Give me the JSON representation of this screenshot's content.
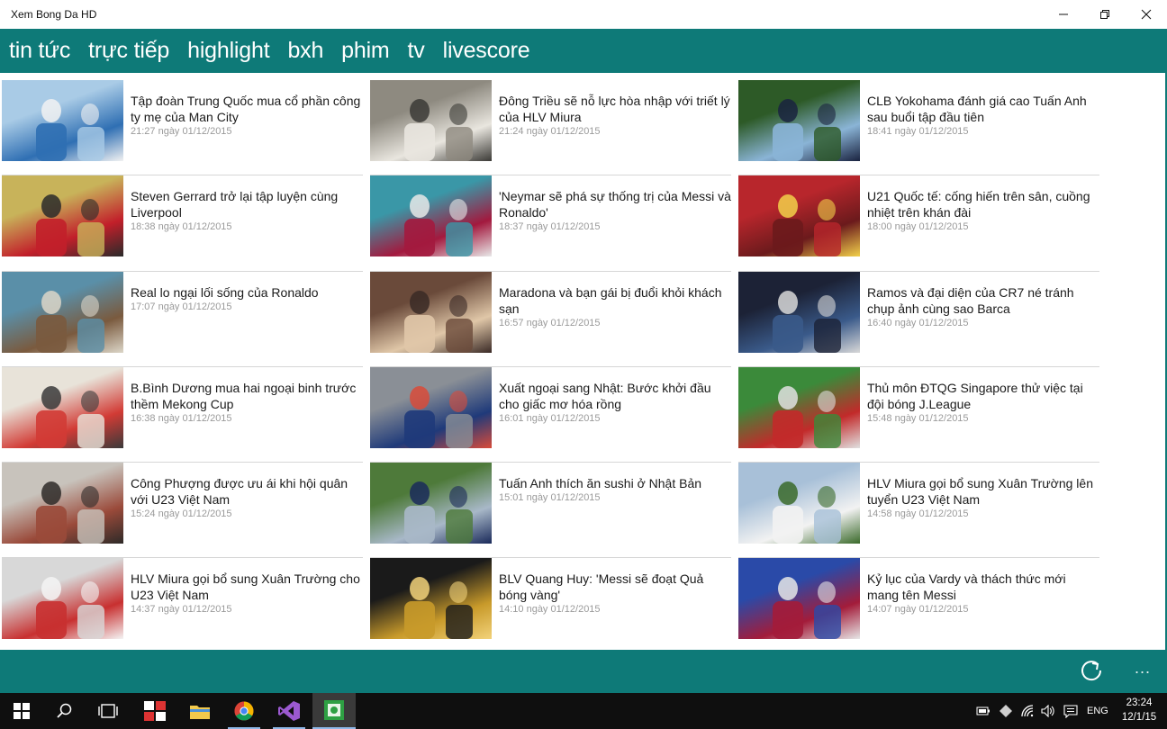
{
  "window": {
    "title": "Xem Bong Da HD",
    "controls": [
      "minimize",
      "restore",
      "close"
    ]
  },
  "nav": {
    "tabs": [
      "tin tức",
      "trực tiếp",
      "highlight",
      "bxh",
      "phim",
      "tv",
      "livescore"
    ]
  },
  "articles": [
    {
      "title": "Tập đoàn Trung Quốc mua cổ phần công ty mẹ của Man City",
      "time": "21:27 ngày 01/12/2015",
      "thumb": "photo-man-city-players"
    },
    {
      "title": "Đông Triều sẽ nỗ lực hòa nhập với triết lý của HLV Miura",
      "time": "21:24 ngày 01/12/2015",
      "thumb": "photo-player-portrait"
    },
    {
      "title": "CLB Yokohama đánh giá cao Tuấn Anh sau buổi tập đầu tiên",
      "time": "18:41 ngày 01/12/2015",
      "thumb": "photo-training-field"
    },
    {
      "title": "Steven Gerrard trở lại tập luyện cùng Liverpool",
      "time": "18:38 ngày 01/12/2015",
      "thumb": "photo-liverpool-training"
    },
    {
      "title": "'Neymar sẽ phá sự thống trị của Messi và Ronaldo'",
      "time": "18:37 ngày 01/12/2015",
      "thumb": "photo-three-stars"
    },
    {
      "title": "U21 Quốc tế: cống hiến trên sân, cuồng nhiệt trên khán đài",
      "time": "18:00 ngày 01/12/2015",
      "thumb": "photo-stadium-crowd"
    },
    {
      "title": "Real lo ngại lối sống của Ronaldo",
      "time": "17:07 ngày 01/12/2015",
      "thumb": "photo-pool-party"
    },
    {
      "title": "Maradona và bạn gái bị đuổi khỏi khách sạn",
      "time": "16:57 ngày 01/12/2015",
      "thumb": "photo-couple"
    },
    {
      "title": "Ramos và đại diện của CR7 né tránh chụp ảnh cùng sao Barca",
      "time": "16:40 ngày 01/12/2015",
      "thumb": "photo-gala-group"
    },
    {
      "title": "B.Bình Dương mua hai ngoại binh trước thềm Mekong Cup",
      "time": "16:38 ngày 01/12/2015",
      "thumb": "photo-jersey-signing"
    },
    {
      "title": "Xuất ngoại sang Nhật: Bước khởi đầu cho giấc mơ hóa rồng",
      "time": "16:01 ngày 01/12/2015",
      "thumb": "photo-airport-fans"
    },
    {
      "title": "Thủ môn ĐTQG Singapore thử việc tại đội bóng J.League",
      "time": "15:48 ngày 01/12/2015",
      "thumb": "photo-goalkeeper-save"
    },
    {
      "title": "Công Phượng được ưu ái khi hội quân với U23 Việt Nam",
      "time": "15:24 ngày 01/12/2015",
      "thumb": "photo-player-guitar"
    },
    {
      "title": "Tuấn Anh thích ăn sushi ở Nhật Bản",
      "time": "15:01 ngày 01/12/2015",
      "thumb": "photo-pitch-player"
    },
    {
      "title": "HLV Miura gọi bổ sung Xuân Trường lên tuyển U23 Việt Nam",
      "time": "14:58 ngày 01/12/2015",
      "thumb": "photo-player-celebrating"
    },
    {
      "title": "HLV Miura gọi bổ sung Xuân Trường cho U23 Việt Nam",
      "time": "14:37 ngày 01/12/2015",
      "thumb": "photo-player-running"
    },
    {
      "title": "BLV Quang Huy: 'Messi sẽ đoạt Quả bóng vàng'",
      "time": "14:10 ngày 01/12/2015",
      "thumb": "photo-golden-balls"
    },
    {
      "title": "Kỷ lục của Vardy và thách thức mới mang tên Messi",
      "time": "14:07 ngày 01/12/2015",
      "thumb": "photo-vardy-messi"
    }
  ],
  "appbar": {
    "refresh_icon": "refresh-icon",
    "more_label": "..."
  },
  "taskbar": {
    "apps": [
      "start",
      "search",
      "task-view",
      "app-tiles",
      "file-explorer",
      "chrome",
      "visual-studio",
      "xem-bong-da"
    ],
    "language": "ENG",
    "time": "23:24",
    "date": "12/1/15"
  },
  "colors": {
    "accent": "#0e7a78",
    "taskbar": "#0f0f0f"
  }
}
